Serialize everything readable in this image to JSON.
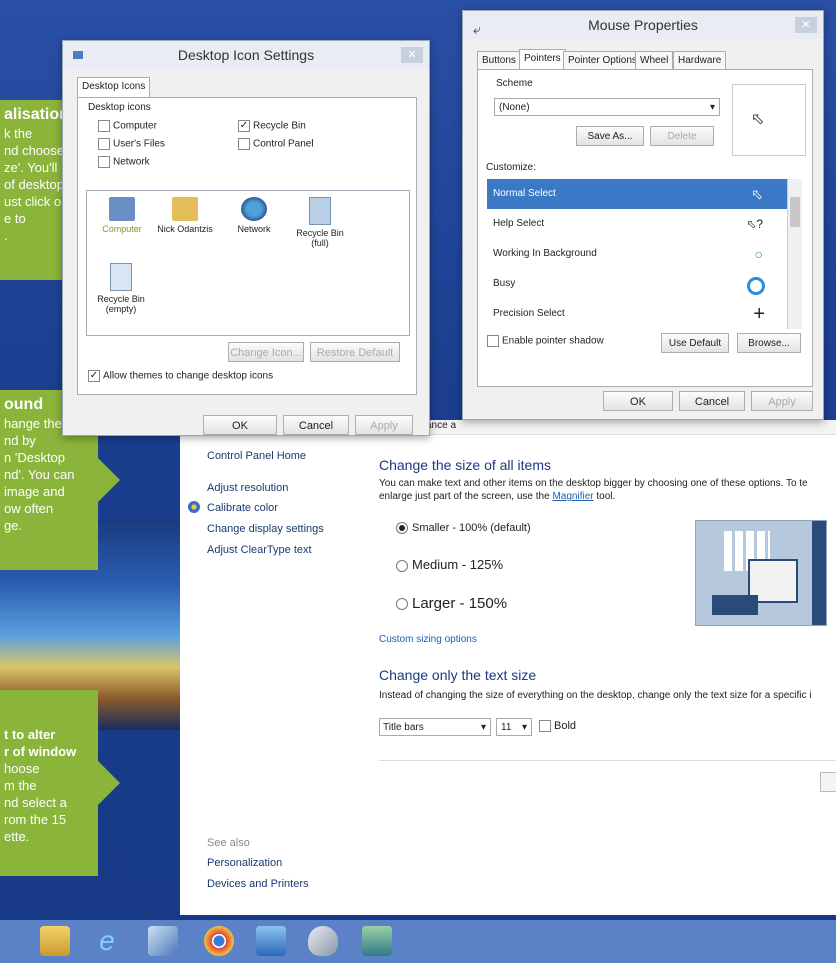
{
  "desktop_icon_settings": {
    "title": "Desktop Icon Settings",
    "tab": "Desktop Icons",
    "group_label": "Desktop icons",
    "checkboxes": [
      {
        "label": "Computer",
        "checked": false
      },
      {
        "label": "Recycle Bin",
        "checked": true
      },
      {
        "label": "User's Files",
        "checked": false
      },
      {
        "label": "Control Panel",
        "checked": false
      },
      {
        "label": "Network",
        "checked": false
      }
    ],
    "icons": [
      "Computer",
      "Nick Odantzis",
      "Network",
      "Recycle Bin (full)",
      "Recycle Bin (empty)"
    ],
    "change_icon": "Change Icon...",
    "restore_default": "Restore Default",
    "allow_themes": "Allow themes to change desktop icons",
    "ok": "OK",
    "cancel": "Cancel",
    "apply": "Apply"
  },
  "mouse_properties": {
    "title": "Mouse Properties",
    "tabs": [
      "Buttons",
      "Pointers",
      "Pointer Options",
      "Wheel",
      "Hardware"
    ],
    "scheme_label": "Scheme",
    "scheme_value": "(None)",
    "save_as": "Save As...",
    "delete": "Delete",
    "customize_label": "Customize:",
    "pointers": [
      "Normal Select",
      "Help Select",
      "Working In Background",
      "Busy",
      "Precision Select"
    ],
    "enable_shadow": "Enable pointer shadow",
    "use_default": "Use Default",
    "browse": "Browse...",
    "ok": "OK",
    "cancel": "Cancel",
    "apply": "Apply"
  },
  "control_panel": {
    "top_partial": "ance a",
    "nav_home": "Control Panel Home",
    "nav_links": [
      "Adjust resolution",
      "Calibrate color",
      "Change display settings",
      "Adjust ClearType text"
    ],
    "see_also": "See also",
    "see_also_links": [
      "Personalization",
      "Devices and Printers"
    ],
    "heading1": "Change the size of all items",
    "desc1a": "You can make text and other items on the desktop bigger by choosing one of these options. To te",
    "desc1b": "enlarge just part of the screen, use the",
    "magnifier": "Magnifier",
    "desc1c": "tool.",
    "options": [
      {
        "label": "Smaller - 100% (default)",
        "selected": true
      },
      {
        "label": "Medium - 125%",
        "selected": false
      },
      {
        "label": "Larger - 150%",
        "selected": false
      }
    ],
    "custom_sizing": "Custom sizing options",
    "heading2": "Change only the text size",
    "desc2": "Instead of changing the size of everything on the desktop, change only the text size for a specific i",
    "item_select": "Title bars",
    "size_select": "11",
    "bold_label": "Bold"
  },
  "callouts": {
    "c1_title": "alisation",
    "c1_lines": [
      "k the",
      "nd choose",
      "ze'. You'll",
      "of desktop",
      "ust click or",
      "e to",
      "."
    ],
    "c2_title": "ound",
    "c2_lines": [
      "hange the",
      "nd by",
      "n 'Desktop",
      "nd'. You can",
      "image and",
      "ow often",
      "ge."
    ],
    "c3_lines": [
      "t to alter",
      "r of window",
      "hoose",
      "m the",
      "nd select a",
      "rom the 15",
      "ette."
    ]
  },
  "colors": {
    "accent_green": "#8ab43a",
    "selection_blue": "#3b79c6",
    "link_blue": "#1a5fb4"
  }
}
